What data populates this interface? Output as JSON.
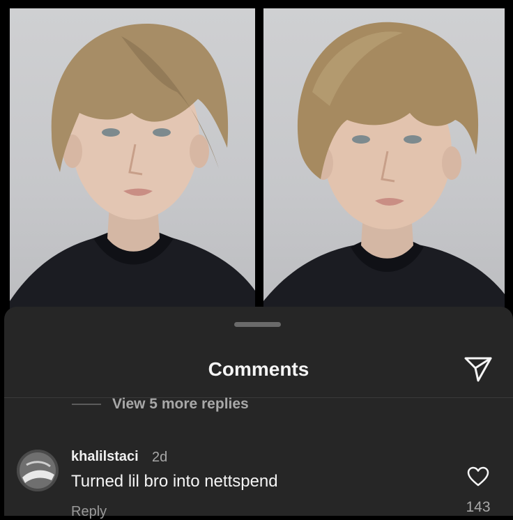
{
  "sheet": {
    "title": "Comments",
    "share_icon": "send-icon"
  },
  "thread": {
    "view_replies": "View 5 more replies"
  },
  "comment": {
    "username": "khalilstaci",
    "time": "2d",
    "text": "Turned lil bro into nettspend",
    "reply_label": "Reply",
    "likes": "143",
    "like_icon": "heart-icon"
  },
  "colors": {
    "sheet_bg": "#262626",
    "text_primary": "#f5f5f5",
    "text_secondary": "#a8a8a8"
  }
}
